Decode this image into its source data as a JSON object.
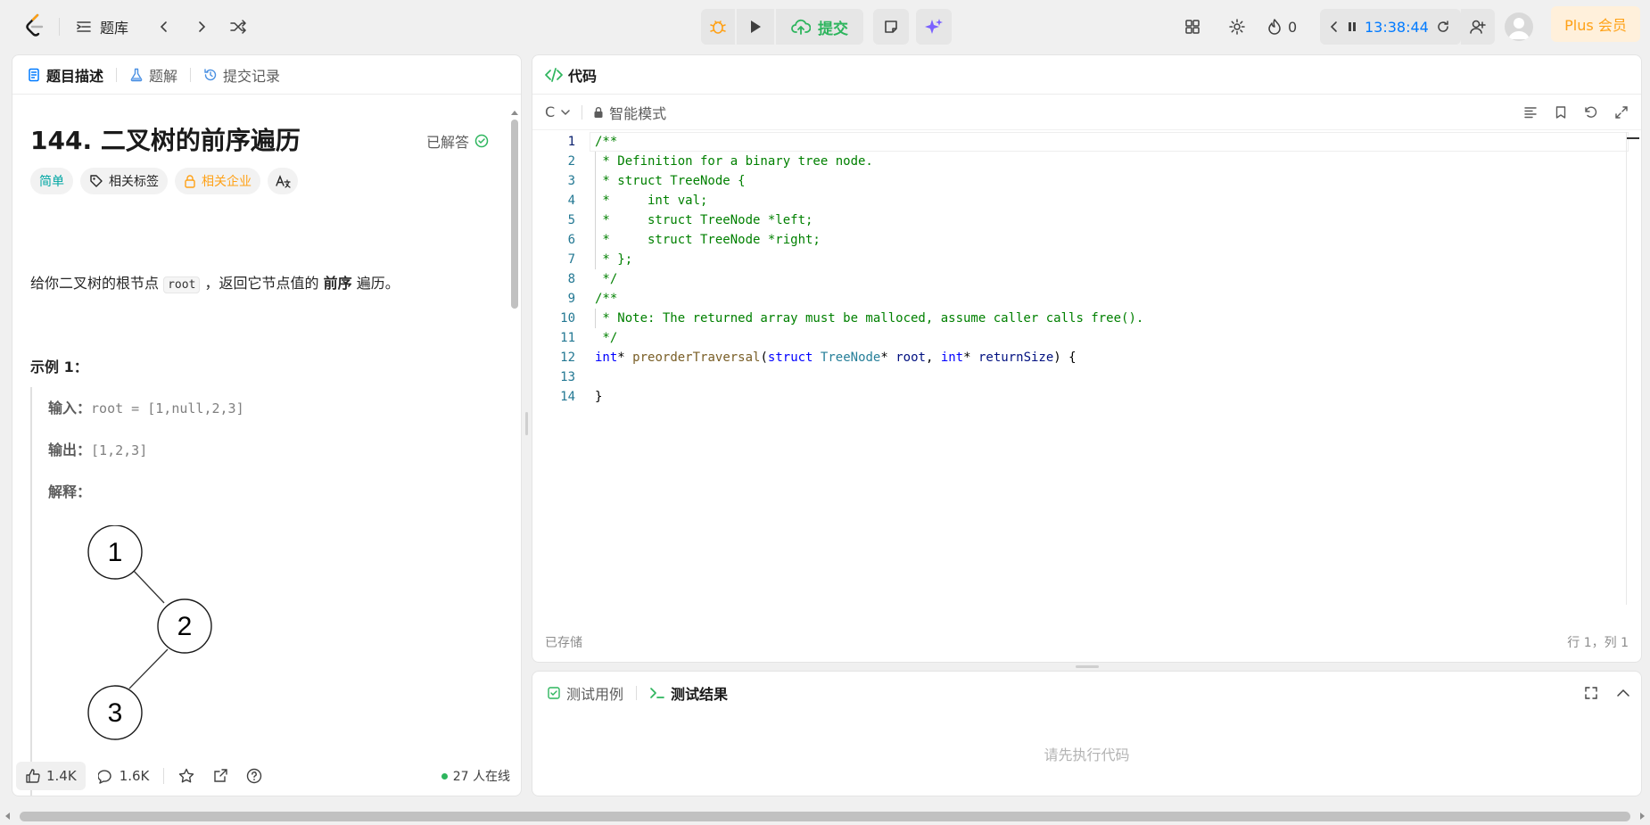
{
  "topbar": {
    "problem_list": "题库",
    "submit": "提交",
    "streak": "0",
    "timer": "13:38:44",
    "plus": "Plus 会员"
  },
  "left": {
    "tabs": [
      "题目描述",
      "题解",
      "提交记录"
    ],
    "title": "144. 二叉树的前序遍历",
    "solved": "已解答",
    "chips": {
      "difficulty": "简单",
      "tags": "相关标签",
      "companies": "相关企业"
    },
    "desc_prefix": "给你二叉树的根节点 ",
    "desc_code": "root",
    "desc_mid": " ，返回它节点值的 ",
    "desc_bold": "前序",
    "desc_suffix": " 遍历。",
    "example_title": "示例 1：",
    "input_label": "输入：",
    "input_value": "root = [1,null,2,3]",
    "output_label": "输出：",
    "output_value": "[1,2,3]",
    "explain_label": "解释：",
    "tree_nodes": [
      "1",
      "2",
      "3"
    ],
    "likes": "1.4K",
    "comments": "1.6K",
    "online": "27 人在线"
  },
  "code": {
    "tab": "代码",
    "language": "C",
    "mode": "智能模式",
    "lines": [
      "/**",
      " * Definition for a binary tree node.",
      " * struct TreeNode {",
      " *     int val;",
      " *     struct TreeNode *left;",
      " *     struct TreeNode *right;",
      " * };",
      " */",
      "/**",
      " * Note: The returned array must be malloced, assume caller calls free().",
      " */",
      "int* preorderTraversal(struct TreeNode* root, int* returnSize) {",
      "",
      "}"
    ],
    "saved": "已存储",
    "cursor": "行 1，列 1"
  },
  "test": {
    "tabs": [
      "测试用例",
      "测试结果"
    ],
    "placeholder": "请先执行代码"
  },
  "colors": {
    "accent_green": "#2db55d",
    "easy": "#00a6a3",
    "premium": "#ffa116",
    "timer": "#007aff"
  }
}
